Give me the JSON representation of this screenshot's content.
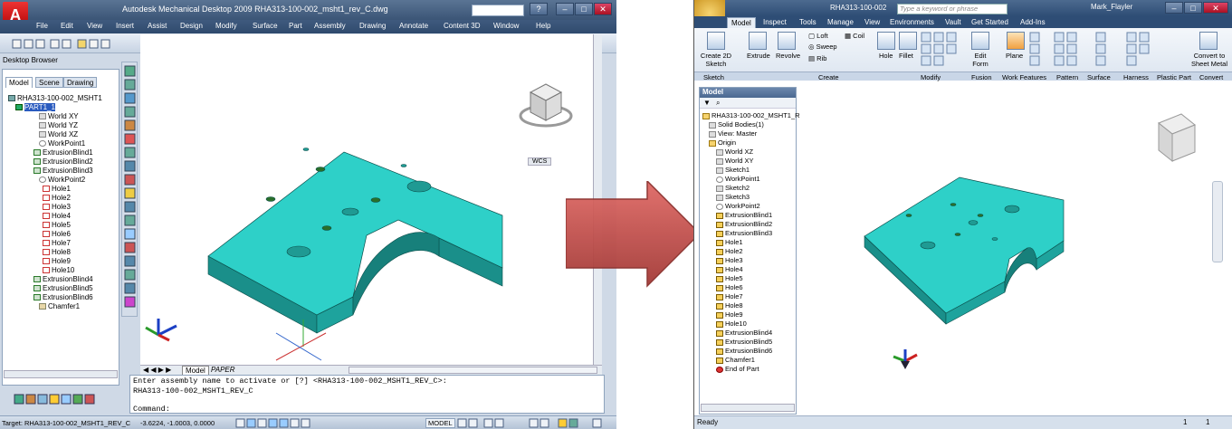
{
  "left": {
    "title": "Autodesk Mechanical Desktop 2009   RHA313-100-002_msht1_rev_C.dwg",
    "menu": [
      "File",
      "Edit",
      "View",
      "Insert",
      "Assist",
      "Design",
      "Modify",
      "Surface",
      "Part",
      "Assembly",
      "Drawing",
      "Annotate",
      "Content 3D",
      "Window",
      "Help"
    ],
    "browser_title": "Desktop Browser",
    "tabs": [
      "Model",
      "Scene",
      "Drawing"
    ],
    "tree": [
      "RHA313-100-002_MSHT1",
      "PART1_1",
      "World XY",
      "World YZ",
      "World XZ",
      "WorkPoint1",
      "ExtrusionBlind1",
      "ExtrusionBlind2",
      "ExtrusionBlind3",
      "WorkPoint2",
      "Hole1",
      "Hole2",
      "Hole3",
      "Hole4",
      "Hole5",
      "Hole6",
      "Hole7",
      "Hole8",
      "Hole9",
      "Hole10",
      "ExtrusionBlind4",
      "ExtrusionBlind5",
      "ExtrusionBlind6",
      "Chamfer1"
    ],
    "viewcube_wcs": "WCS",
    "layout_tabs": [
      "Model",
      "PAPER"
    ],
    "cmd_line1": "Enter assembly name to activate or [?] <RHA313-100-002_MSHT1_REV_C>:",
    "cmd_line2": "RHA313-100-002_MSHT1_REV_C",
    "cmd_prompt": "Command:",
    "status_target": "Target: RHA313-100-002_MSHT1_REV_C",
    "status_coords": "-3.6224, -1.0003, 0.0000",
    "status_model": "MODEL"
  },
  "right": {
    "title": "RHA313-100-002",
    "search_placeholder": "Type a keyword or phrase",
    "user": "Mark_Flayler",
    "tabs": [
      "Model",
      "Inspect",
      "Tools",
      "Manage",
      "View",
      "Environments",
      "Vault",
      "Get Started",
      "Add-Ins"
    ],
    "ribbon": {
      "create_sketch": "Create 2D Sketch",
      "extrude": "Extrude",
      "revolve": "Revolve",
      "loft": "Loft",
      "sweep": "Sweep",
      "rib": "Rib",
      "coil": "Coil",
      "hole": "Hole",
      "fillet": "Fillet",
      "edit_form": "Edit Form",
      "plane": "Plane",
      "convert": "Convert to Sheet Metal"
    },
    "panels": [
      "Sketch",
      "Create",
      "Modify",
      "Fusion",
      "Work Features",
      "Pattern",
      "Surface",
      "Harness",
      "Plastic Part",
      "Convert"
    ],
    "browser_title": "Model",
    "tree": [
      "RHA313-100-002_MSHT1_R",
      "Solid Bodies(1)",
      "View: Master",
      "Origin",
      "World XZ",
      "World XY",
      "Sketch1",
      "WorkPoint1",
      "Sketch2",
      "Sketch3",
      "WorkPoint2",
      "ExtrusionBlind1",
      "ExtrusionBlind2",
      "ExtrusionBlind3",
      "Hole1",
      "Hole2",
      "Hole3",
      "Hole4",
      "Hole5",
      "Hole6",
      "Hole7",
      "Hole8",
      "Hole9",
      "Hole10",
      "ExtrusionBlind4",
      "ExtrusionBlind5",
      "ExtrusionBlind6",
      "Chamfer1",
      "End of Part"
    ],
    "status": "Ready",
    "status_nums": [
      "1",
      "1"
    ]
  },
  "colors": {
    "part": "#2ed0c8",
    "part_dark": "#1a8f8a",
    "arrow": "#c0504d"
  }
}
